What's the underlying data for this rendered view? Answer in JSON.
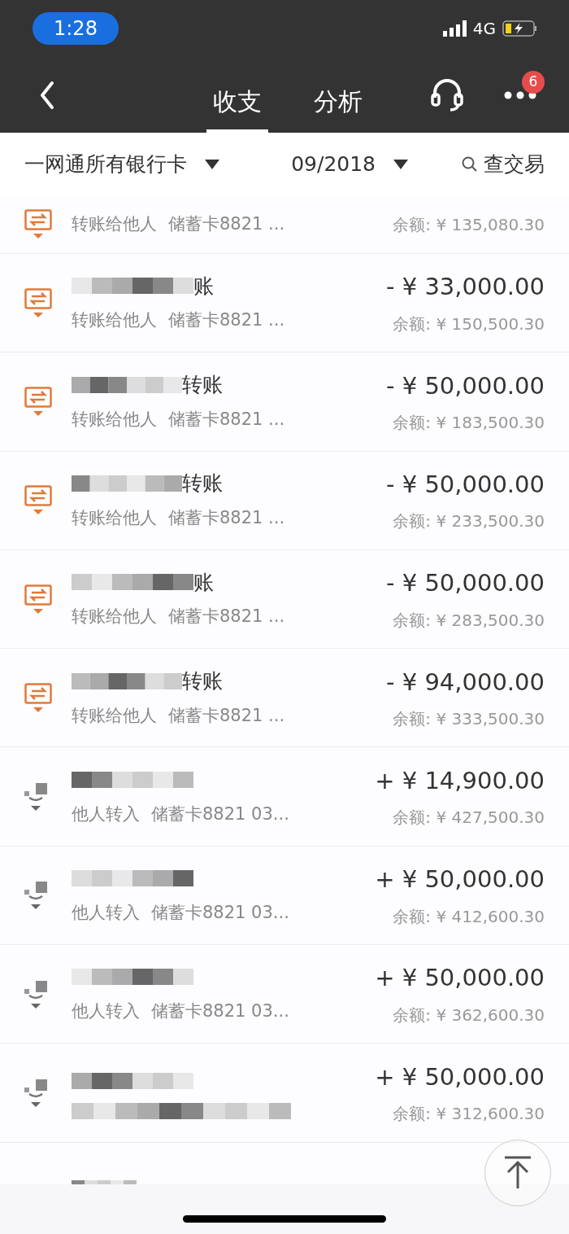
{
  "status_bar": {
    "time": "1:28",
    "network": "4G"
  },
  "nav": {
    "tabs": [
      {
        "label": "收支",
        "selected": true
      },
      {
        "label": "分析",
        "selected": false
      }
    ],
    "badge": "6"
  },
  "filters": {
    "account": "一网通所有银行卡",
    "month": "09/2018",
    "search": "查交易"
  },
  "rows": [
    {
      "kind": "cut_top",
      "subtitle": "转账给他人",
      "card": "储蓄卡8821 ...",
      "balance": "余额: ¥ 135,080.30"
    },
    {
      "kind": "out",
      "title": "账",
      "amount": "- ¥ 33,000.00",
      "subtitle": "转账给他人",
      "card": "储蓄卡8821 ...",
      "balance": "余额: ¥ 150,500.30"
    },
    {
      "kind": "out",
      "title": "转账",
      "amount": "- ¥ 50,000.00",
      "subtitle": "转账给他人",
      "card": "储蓄卡8821 ...",
      "balance": "余额: ¥ 183,500.30"
    },
    {
      "kind": "out",
      "title": "转账",
      "amount": "- ¥ 50,000.00",
      "subtitle": "转账给他人",
      "card": "储蓄卡8821 ...",
      "balance": "余额: ¥ 233,500.30"
    },
    {
      "kind": "out",
      "title": "账",
      "amount": "- ¥ 50,000.00",
      "subtitle": "转账给他人",
      "card": "储蓄卡8821 ...",
      "balance": "余额: ¥ 283,500.30"
    },
    {
      "kind": "out",
      "title": "转账",
      "amount": "- ¥ 94,000.00",
      "subtitle": "转账给他人",
      "card": "储蓄卡8821 ...",
      "balance": "余额: ¥ 333,500.30"
    },
    {
      "kind": "in",
      "amount": "+ ¥ 14,900.00",
      "subtitle": "他人转入",
      "card": "储蓄卡8821 03...",
      "balance": "余额: ¥ 427,500.30"
    },
    {
      "kind": "in",
      "amount": "+ ¥ 50,000.00",
      "subtitle": "他人转入",
      "card": "储蓄卡8821 03...",
      "balance": "余额: ¥ 412,600.30"
    },
    {
      "kind": "in",
      "amount": "+ ¥ 50,000.00",
      "subtitle": "他人转入",
      "card": "储蓄卡8821 03...",
      "balance": "余额: ¥ 362,600.30"
    },
    {
      "kind": "in",
      "amount": "+ ¥ 50,000.00",
      "balance": "余额: ¥ 312,600.30"
    },
    {
      "kind": "cut_bottom"
    }
  ]
}
